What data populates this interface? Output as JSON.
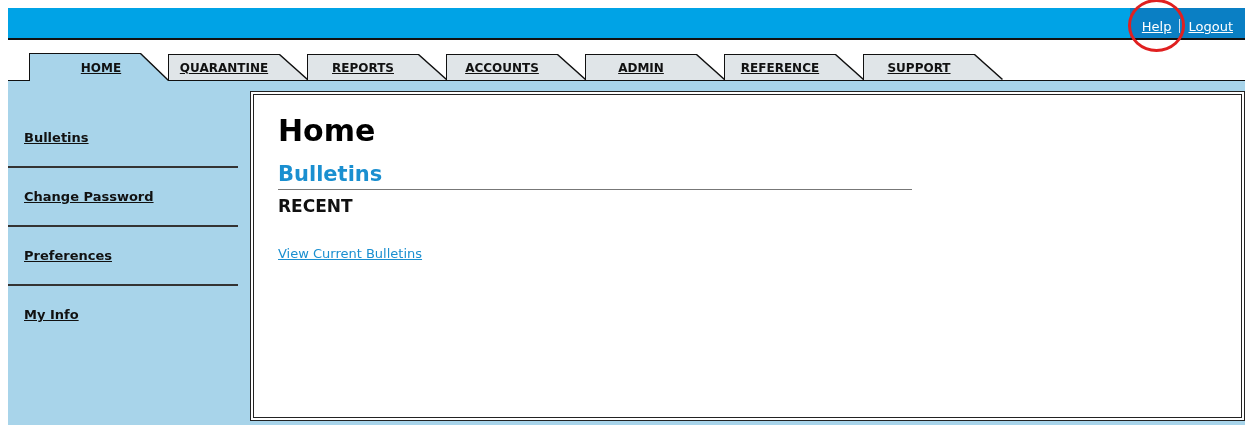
{
  "top_links": [
    {
      "label": "Help",
      "highlighted": true
    },
    {
      "label": "Logout",
      "highlighted": false
    }
  ],
  "tabs": [
    {
      "label": "HOME",
      "selected": true
    },
    {
      "label": "QUARANTINE",
      "selected": false
    },
    {
      "label": "REPORTS",
      "selected": false
    },
    {
      "label": "ACCOUNTS",
      "selected": false
    },
    {
      "label": "ADMIN",
      "selected": false
    },
    {
      "label": "REFERENCE",
      "selected": false
    },
    {
      "label": "SUPPORT",
      "selected": false
    }
  ],
  "sidebar": {
    "items": [
      {
        "label": "Bulletins"
      },
      {
        "label": "Change Password"
      },
      {
        "label": "Preferences"
      },
      {
        "label": "My Info"
      }
    ]
  },
  "content": {
    "title": "Home",
    "section": "Bulletins",
    "subheading": "RECENT",
    "link": "View Current Bulletins"
  }
}
